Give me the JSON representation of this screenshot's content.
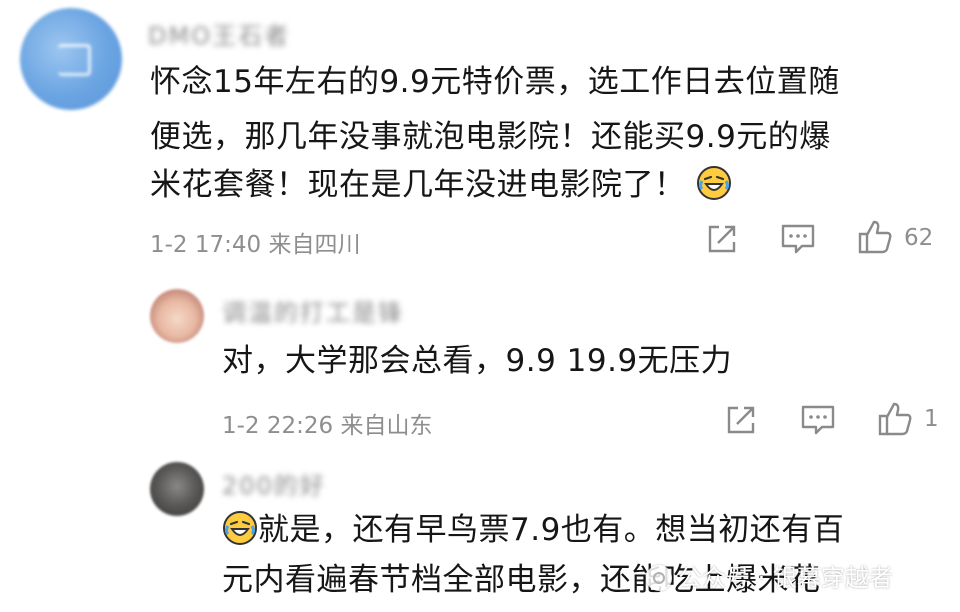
{
  "comments": [
    {
      "username": "DMO王石者",
      "lines": [
        "怀念15年左右的9.9元特价票，选工作日去位置随",
        "便选，那几年没事就泡电影院！还能买9.9元的爆",
        "米花套餐！现在是几年没进电影院了！"
      ],
      "emoji": "laughing-crying-emoji",
      "time": "1-2 17:40",
      "location": "来自四川",
      "likes": "62"
    },
    {
      "username": "调温的打工是锋",
      "lines": [
        "对，大学那会总看，9.9 19.9无压力"
      ],
      "time": "1-2 22:26",
      "location": "来自山东",
      "likes": "1"
    },
    {
      "username": "200的好",
      "lines": [
        "就是，还有早鸟票7.9也有。想当初还有百",
        "元内看遍春节档全部电影，还能吃上爆米花"
      ],
      "emoji": "laughing-crying-emoji"
    }
  ],
  "watermark": "公众号 · 银幕穿越者",
  "colors": {
    "text": "#161616",
    "meta": "#8e8e8e",
    "avatar_blue": "#6aa4e2"
  },
  "icons": [
    "share-icon",
    "comment-icon",
    "like-icon"
  ]
}
